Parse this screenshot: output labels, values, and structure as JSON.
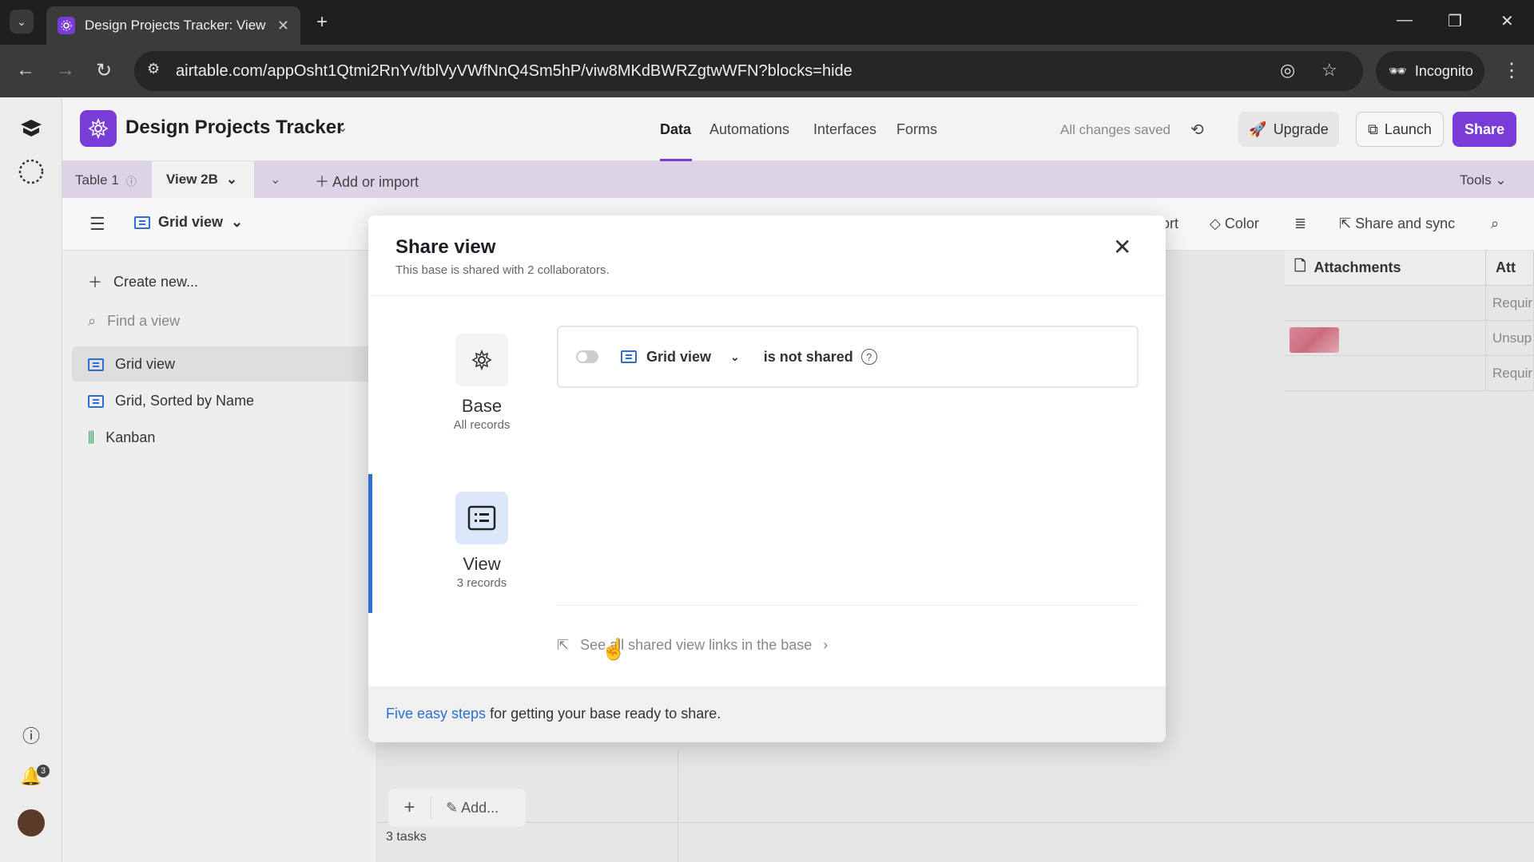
{
  "browser": {
    "tab_title": "Design Projects Tracker: View 2B",
    "url": "airtable.com/appOsht1Qtmi2RnYv/tblVyVWfNnQ4Sm5hP/viw8MKdBWRZgtwWFN?blocks=hide",
    "incognito_label": "Incognito"
  },
  "app": {
    "base_name": "Design Projects Tracker",
    "top_tabs": [
      "Data",
      "Automations",
      "Interfaces",
      "Forms"
    ],
    "saved_status": "All changes saved",
    "upgrade_label": "Upgrade",
    "launch_label": "Launch",
    "share_label": "Share",
    "notification_count": "3"
  },
  "tablebar": {
    "table_name": "Table 1",
    "view_tab": "View 2B",
    "add_import": "Add or import",
    "tools": "Tools"
  },
  "viewbar": {
    "view_name": "Grid view",
    "tools": [
      "ort",
      "Color",
      "Share and sync"
    ]
  },
  "sidebar": {
    "create_new": "Create new...",
    "find_placeholder": "Find a view",
    "views": [
      "Grid view",
      "Grid, Sorted by Name",
      "Kanban"
    ]
  },
  "grid": {
    "columns": [
      "Attachments",
      "Att"
    ],
    "cells": [
      "Requir",
      "Unsup",
      "Requir"
    ],
    "add_label": "Add...",
    "record_count": "3 tasks"
  },
  "modal": {
    "title": "Share view",
    "subtitle": "This base is shared with 2 collaborators.",
    "options": [
      {
        "label": "Base",
        "count": "All records"
      },
      {
        "label": "View",
        "count": "3 records"
      }
    ],
    "view_select": "Grid view",
    "share_status": "is not shared",
    "links_text": "See all shared view links in the base",
    "footer_link": "Five easy steps",
    "footer_text": " for getting your base ready to share."
  },
  "colors": {
    "accent": "#7a3cd6",
    "link": "#2d6fd1"
  }
}
